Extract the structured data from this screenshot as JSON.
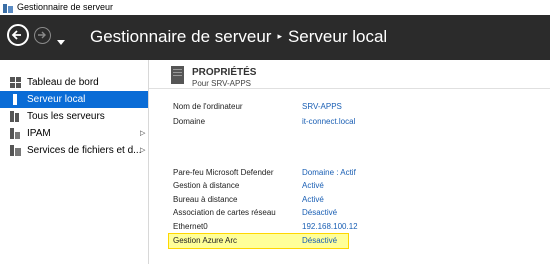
{
  "window": {
    "title": "Gestionnaire de serveur"
  },
  "header": {
    "breadcrumb_root": "Gestionnaire de serveur",
    "breadcrumb_separator": "▸",
    "breadcrumb_current": "Serveur local"
  },
  "sidebar": {
    "items": [
      {
        "label": "Tableau de bord",
        "icon": "dashboard-icon"
      },
      {
        "label": "Serveur local",
        "icon": "server-icon",
        "selected": true
      },
      {
        "label": "Tous les serveurs",
        "icon": "servers-icon"
      },
      {
        "label": "IPAM",
        "icon": "ipam-icon",
        "expandable": true
      },
      {
        "label": "Services de fichiers et d...",
        "icon": "file-services-icon",
        "expandable": true
      }
    ],
    "chevron": "▷"
  },
  "properties": {
    "title": "PROPRIÉTÉS",
    "subtitle": "Pour SRV-APPS",
    "rows": [
      {
        "label": "Nom de l'ordinateur",
        "value": "SRV-APPS"
      },
      {
        "label": "Domaine",
        "value": "it-connect.local"
      },
      {
        "label": "Pare-feu Microsoft Defender",
        "value": "Domaine : Actif"
      },
      {
        "label": "Gestion à distance",
        "value": "Activé"
      },
      {
        "label": "Bureau à distance",
        "value": "Activé"
      },
      {
        "label": "Association de cartes réseau",
        "value": "Désactivé"
      },
      {
        "label": "Ethernet0",
        "value": "192.168.100.12"
      },
      {
        "label": "Gestion Azure Arc",
        "value": "Désactivé"
      }
    ]
  },
  "colors": {
    "header_bg": "#2b2b2b",
    "selected_bg": "#0a6cd6",
    "link": "#1a5fb4",
    "highlight_bg": "#ffff99",
    "highlight_border": "#ffd700"
  }
}
